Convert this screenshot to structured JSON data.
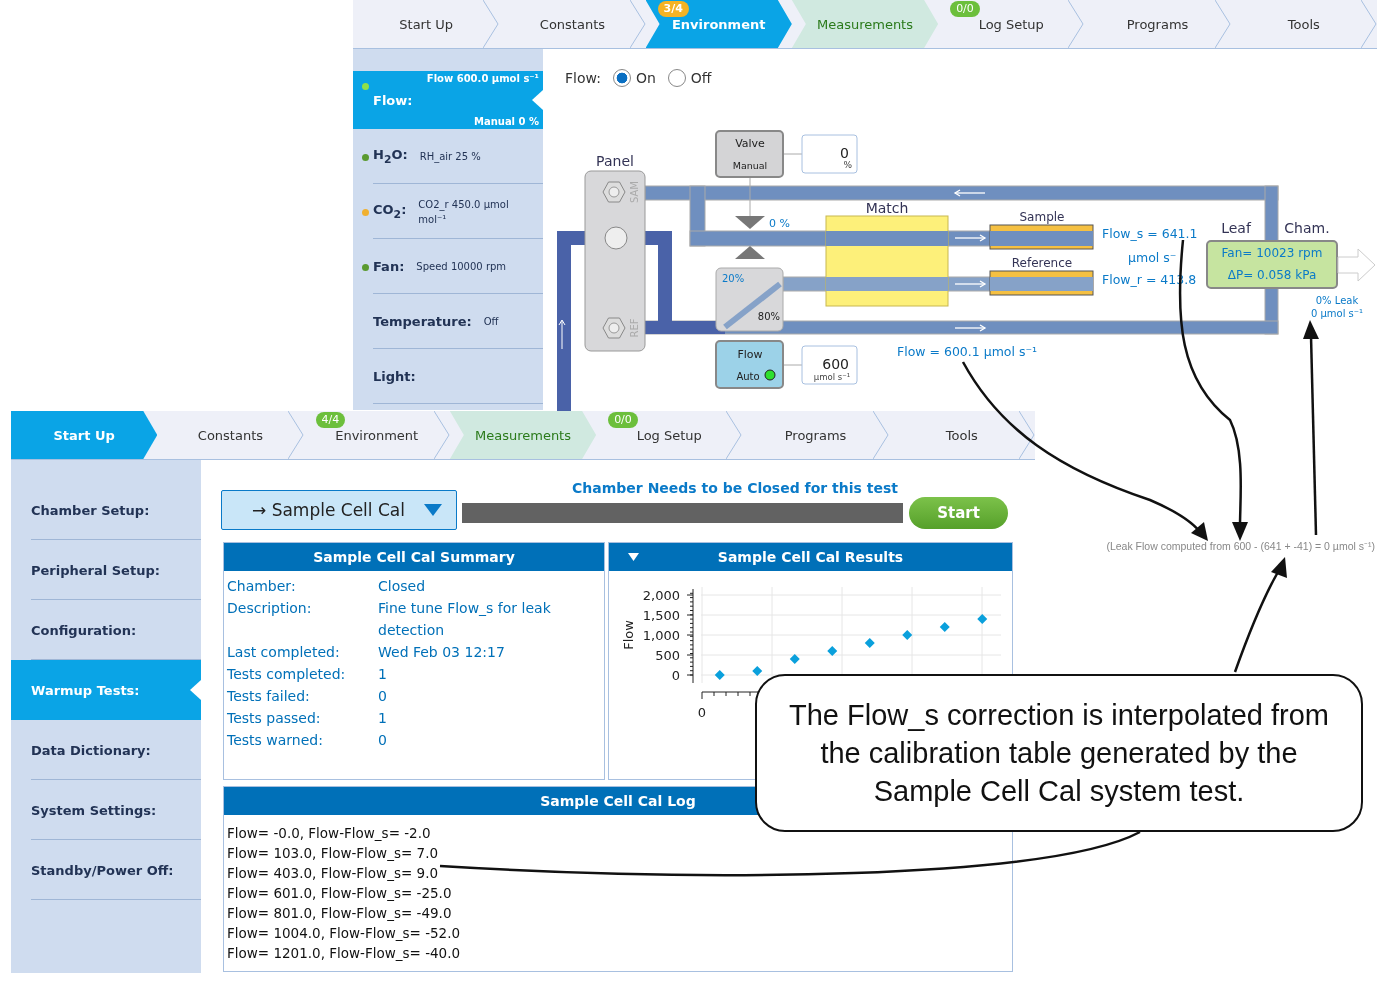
{
  "top_window": {
    "tabs": [
      {
        "label": "Start Up",
        "selected": false,
        "highlighted": false
      },
      {
        "label": "Constants",
        "selected": false,
        "highlighted": false
      },
      {
        "label": "Environment",
        "selected": true,
        "highlighted": false,
        "badge": {
          "text": "3/4",
          "color": "#f5b324"
        }
      },
      {
        "label": "Measurements",
        "selected": false,
        "highlighted": true
      },
      {
        "label": "Log Setup",
        "selected": false,
        "highlighted": false,
        "badge": {
          "text": "0/0",
          "color": "#6cbf3c"
        }
      },
      {
        "label": "Programs",
        "selected": false,
        "highlighted": false
      },
      {
        "label": "Tools",
        "selected": false,
        "highlighted": false
      }
    ],
    "sidebar": {
      "items": [
        {
          "label": "Flow:",
          "value": "Flow 600.0 µmol s⁻¹",
          "mode": "Manual 0 %",
          "selected": true,
          "color": "#8fe04a"
        },
        {
          "label": "H$_{2}$O:",
          "value": "RH_air 25 %",
          "selected": false,
          "color": "#5a9a30"
        },
        {
          "label": "CO$_{2}$:",
          "value": "CO2_r 450.0 µmol mol⁻¹",
          "selected": false,
          "color": "#f0b030"
        },
        {
          "label": "Fan:",
          "value": "Speed 10000 rpm",
          "selected": false,
          "color": "#5a9a30"
        },
        {
          "label": "Temperature:",
          "value": "Off",
          "selected": false
        },
        {
          "label": "Light:",
          "selected": false
        }
      ]
    },
    "flow_control": {
      "label": "Flow:",
      "options": [
        {
          "label": "On",
          "selected": true
        },
        {
          "label": "Off",
          "selected": false
        }
      ]
    },
    "diagram": {
      "panel": "Panel",
      "port_top": "SAM",
      "port_bottom": "REF",
      "valve": {
        "title": "Valve",
        "mode": "Manual",
        "value": "0",
        "unit": "%",
        "opening": "0 %"
      },
      "splitter": {
        "upper": "20%",
        "lower": "80%"
      },
      "flow_ctrl": {
        "title": "Flow",
        "mode": "Auto",
        "value": "600",
        "unit": "µmol s⁻¹"
      },
      "match": "Match",
      "sample": "Sample",
      "reference": "Reference",
      "flow_s": "Flow_s = 641.1",
      "flow_s_unit": "µmol s⁻",
      "flow_r": "Flow_r = 413.8",
      "leaf": "Leaf",
      "chamber": "Cham.",
      "fan": "Fan= 10023 rpm",
      "pressure": "ΔP= 0.058 kPa",
      "leak": "0% Leak",
      "leak_flow": "0 µmol s⁻¹",
      "total_flow": "Flow = 600.1 µmol s⁻¹"
    }
  },
  "bottom_window": {
    "tabs": [
      {
        "label": "Start Up",
        "selected": true,
        "highlighted": false
      },
      {
        "label": "Constants",
        "selected": false,
        "highlighted": false
      },
      {
        "label": "Environment",
        "selected": false,
        "highlighted": false,
        "badge": {
          "text": "4/4",
          "color": "#6cbf3c"
        }
      },
      {
        "label": "Measurements",
        "selected": false,
        "highlighted": true
      },
      {
        "label": "Log Setup",
        "selected": false,
        "highlighted": false,
        "badge": {
          "text": "0/0",
          "color": "#6cbf3c"
        }
      },
      {
        "label": "Programs",
        "selected": false,
        "highlighted": false
      },
      {
        "label": "Tools",
        "selected": false,
        "highlighted": false
      }
    ],
    "sidebar": {
      "items": [
        {
          "label": "Chamber Setup:",
          "selected": false
        },
        {
          "label": "Peripheral Setup:",
          "selected": false
        },
        {
          "label": "Configuration:",
          "selected": false
        },
        {
          "label": "Warmup Tests:",
          "selected": true
        },
        {
          "label": "Data Dictionary:",
          "selected": false
        },
        {
          "label": "System Settings:",
          "selected": false
        },
        {
          "label": "Standby/Power Off:",
          "selected": false
        }
      ]
    },
    "test_select": "→ Sample Cell Cal",
    "message": "Chamber Needs to be Closed for this test",
    "progress": {
      "level": 1
    },
    "start_button": "Start",
    "summary": {
      "title": "Sample Cell Cal Summary",
      "fields": [
        {
          "label": "Chamber:",
          "value": "Closed"
        },
        {
          "label": "Description:",
          "value": "Fine tune Flow_s for leak detection"
        },
        {
          "label": "Last completed:",
          "value": "Wed Feb 03 12:17"
        },
        {
          "label": "Tests completed:",
          "value": "1"
        },
        {
          "label": "Tests failed:",
          "value": "0"
        },
        {
          "label": "Tests passed:",
          "value": "1"
        },
        {
          "label": "Tests warned:",
          "value": "0"
        }
      ]
    },
    "results": {
      "title": "Sample Cell Cal Results",
      "x_origin_label": "0",
      "chart_data": {
        "type": "scatter",
        "ylabel": "Flow",
        "ylim": [
          -200,
          2150
        ],
        "grid": true,
        "yticks": [
          {
            "value": 0,
            "label": "0"
          },
          {
            "value": 500,
            "label": "500"
          },
          {
            "value": 1000,
            "label": "1,000"
          },
          {
            "value": 1500,
            "label": "1,500"
          },
          {
            "value": 2000,
            "label": "2,000"
          }
        ],
        "values": [
          0,
          100,
          400,
          600,
          800,
          1000,
          1200,
          1400
        ]
      }
    },
    "log": {
      "title": "Sample Cell Cal Log",
      "lines": [
        "Flow= -0.0, Flow-Flow_s= -2.0",
        "Flow= 103.0, Flow-Flow_s= 7.0",
        "Flow= 403.0, Flow-Flow_s= 9.0",
        "Flow= 601.0, Flow-Flow_s= -25.0",
        "Flow= 801.0, Flow-Flow_s= -49.0",
        "Flow= 1004.0, Flow-Flow_s= -52.0",
        "Flow= 1201.0, Flow-Flow_s= -40.0"
      ]
    }
  },
  "annotation": {
    "callout": "The Flow_s correction is interpolated from the calibration table generated by the Sample Cell Cal system test.",
    "leak_note": "(Leak Flow computed from 600 - (641 + -41) = 0 µmol s⁻¹)"
  }
}
